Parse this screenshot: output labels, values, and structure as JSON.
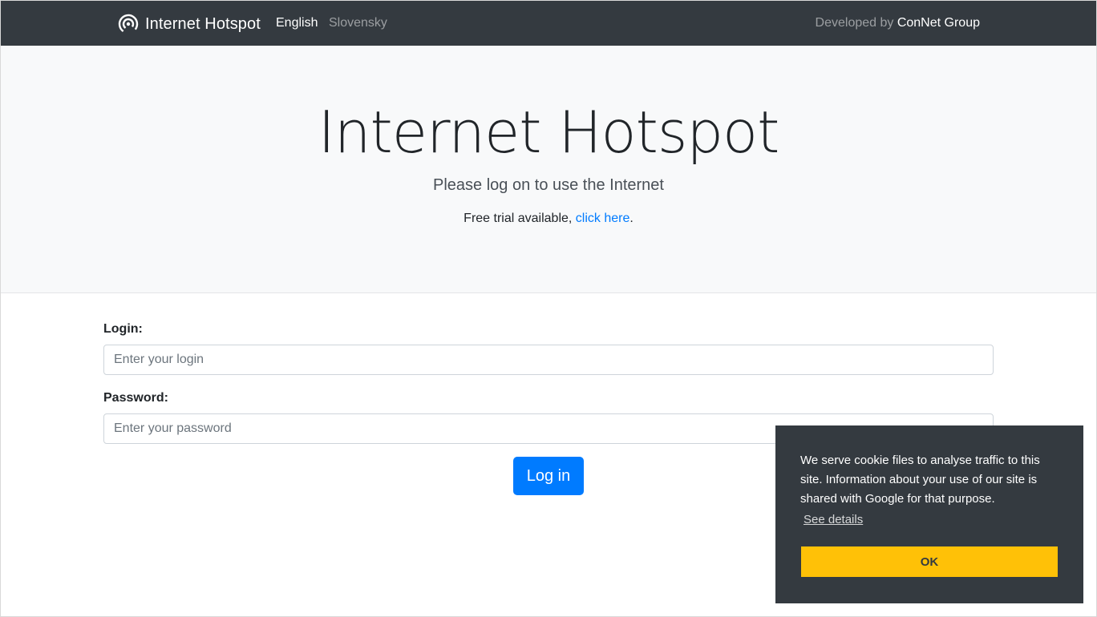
{
  "navbar": {
    "brand": "Internet Hotspot",
    "brand_icon": "hotspot-signal-icon",
    "languages": [
      "English",
      "Slovensky"
    ],
    "active_language": "English",
    "developed_prefix": "Developed by",
    "developer": "ConNet Group"
  },
  "hero": {
    "title": "Internet Hotspot",
    "lead": "Please log on to use the Internet",
    "trial_prefix": "Free trial available,",
    "trial_link": "click here",
    "trial_suffix": "."
  },
  "form": {
    "login_label": "Login:",
    "login_placeholder": "Enter your login",
    "login_value": "",
    "password_label": "Password:",
    "password_placeholder": "Enter your password",
    "password_value": "",
    "submit_label": "Log in"
  },
  "cookie_banner": {
    "message": "We serve cookie files to analyse traffic to this site. Information about your use of our site is shared with Google for that purpose.",
    "details_link": "See details",
    "ok_label": "OK"
  },
  "colors": {
    "navbar_bg": "#343a40",
    "primary": "#007bff",
    "cookie_button": "#ffc107",
    "hero_bg": "#f8f9fa"
  }
}
